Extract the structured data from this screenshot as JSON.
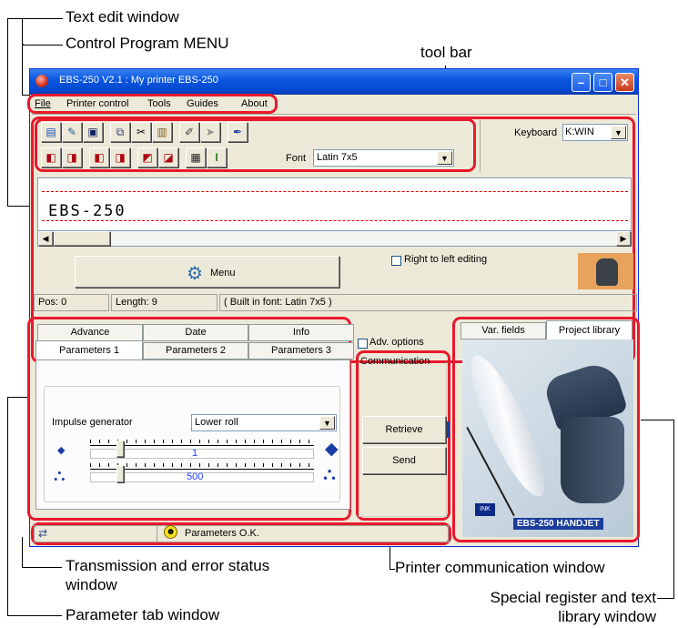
{
  "callouts": {
    "text_edit_window": "Text edit window",
    "control_program_menu": "Control Program MENU",
    "tool_bar": "tool bar",
    "transmission_status_1": "Transmission and error status",
    "transmission_status_2": "window",
    "parameter_tab": "Parameter tab window",
    "printer_comm": "Printer communication window",
    "special_register_1": "Special register and text",
    "special_register_2": "library window"
  },
  "window": {
    "title": "EBS-250 V2.1  :  My printer EBS-250",
    "min_glyph": "–",
    "max_glyph": "□",
    "close_glyph": "✕"
  },
  "menu": {
    "file": "File",
    "printer_control": "Printer control",
    "tools": "Tools",
    "guides": "Guides",
    "about": "About"
  },
  "toolbar": {
    "keyboard_label": "Keyboard",
    "keyboard_value": "K:WIN",
    "font_label": "Font",
    "font_value": "Latin 7x5"
  },
  "editor": {
    "text": "EBS-250",
    "menu_button": "Menu",
    "right_to_left": "Right to left editing"
  },
  "status": {
    "pos": "Pos: 0",
    "length": "Length: 9",
    "font_info": "( Built in font: Latin 7x5 )"
  },
  "params": {
    "tabs_row1": [
      "Advance",
      "Date",
      "Info"
    ],
    "tabs_row2": [
      "Parameters 1",
      "Parameters 2",
      "Parameters 3"
    ],
    "impulse_label": "Impulse generator",
    "impulse_value": "Lower roll",
    "slider1_value": "1",
    "slider2_value": "500",
    "slider1_fraction": 0.12,
    "slider2_fraction": 0.12
  },
  "comm": {
    "adv_options": "Adv. options",
    "group_title": "Communication",
    "retrieve": "Retrieve",
    "send": "Send"
  },
  "library": {
    "tab_var": "Var. fields",
    "tab_project": "Project library",
    "product_caption": "EBS-250  HANDJET"
  },
  "bottom_status": {
    "message": "Parameters O.K."
  },
  "colors": {
    "highlight": "#e8192c",
    "title_blue": "#0a58e0"
  }
}
